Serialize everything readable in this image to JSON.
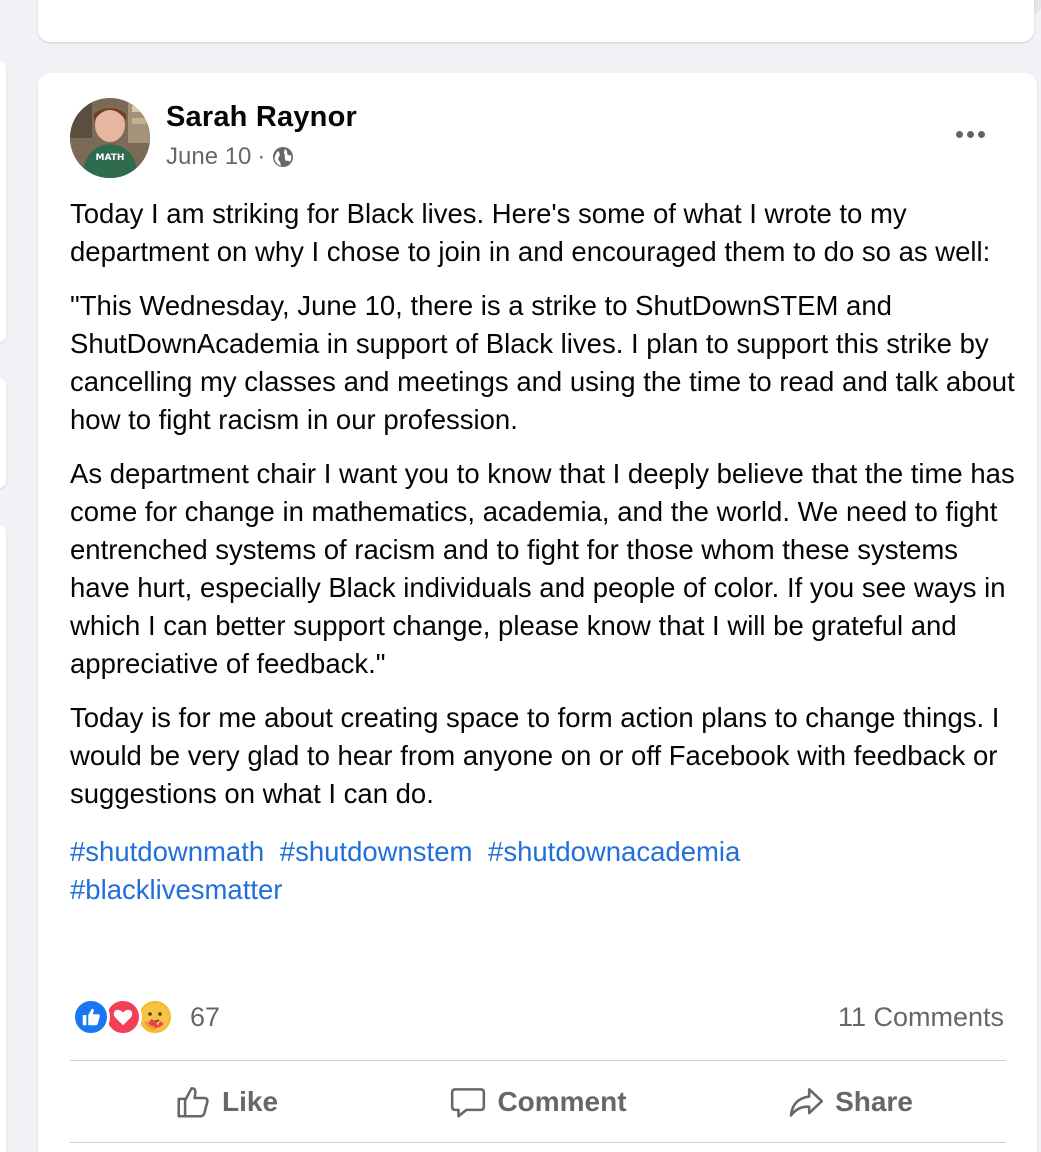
{
  "post": {
    "author": "Sarah Raynor",
    "date": "June 10",
    "separator": "·",
    "audience_icon": "globe-icon",
    "more_icon": "more-options-icon",
    "avatar_shirt_text": "MATH",
    "paragraphs": [
      "Today I am striking for Black lives.  Here's some of what I wrote to my department on why I chose to join in and encouraged them to do so as well:",
      "\"This Wednesday, June 10, there is a strike to ShutDownSTEM and ShutDownAcademia in support of Black lives.  I plan to support this strike by cancelling my classes and meetings and using the time to read and talk about how to fight racism in our profession.",
      "As department chair I want you to know that I deeply believe that the time has come for change in mathematics, academia, and the world.  We need to fight entrenched systems of racism and to fight for those whom these systems have hurt, especially Black individuals and people of color.  If you see ways in which I can better support change, please know that I will be grateful and appreciative of feedback.\"",
      "Today is for me about creating space to form action plans to change things.  I would be very glad to hear from anyone on or off Facebook with feedback or suggestions on what I can do."
    ],
    "hashtags": [
      "#shutdownmath",
      "#shutdownstem",
      "#shutdownacademia",
      "#blacklivesmatter"
    ],
    "reactions": {
      "icons": [
        "like-reaction-icon",
        "love-reaction-icon",
        "care-reaction-icon"
      ],
      "count": "67"
    },
    "comments_count": "11 Comments",
    "actions": {
      "like": "Like",
      "comment": "Comment",
      "share": "Share"
    },
    "colors": {
      "link": "#216fdb",
      "like_blue": "#1877f2",
      "love_red": "#f33e58",
      "care_yellow": "#f7b928",
      "muted": "#65676b"
    }
  }
}
